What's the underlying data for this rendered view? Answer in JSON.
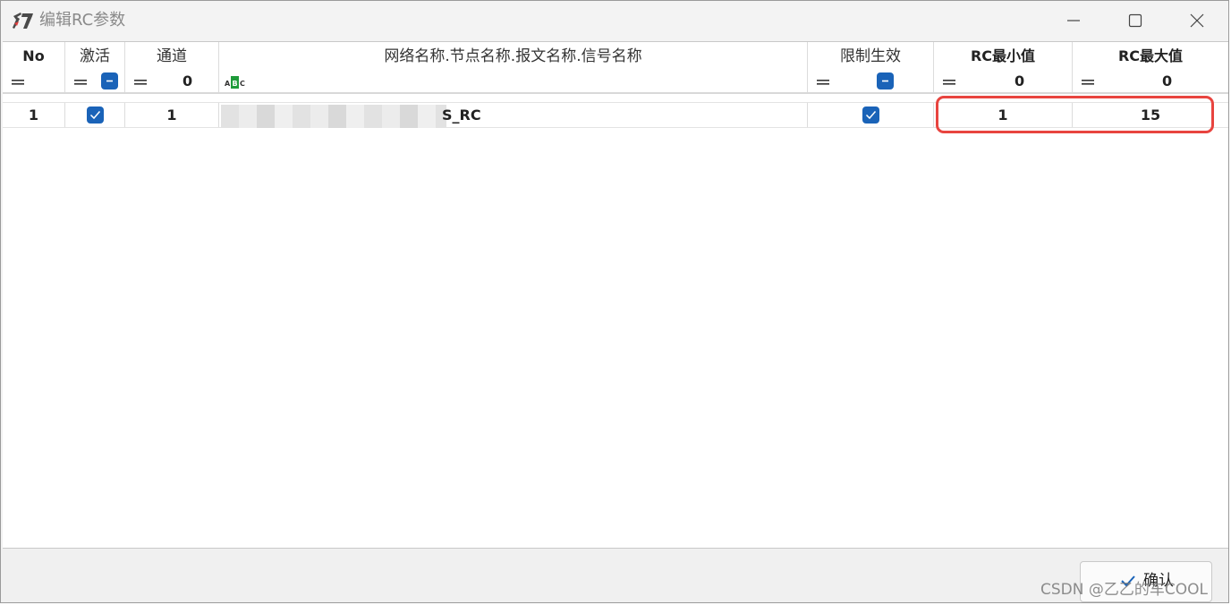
{
  "window": {
    "title": "编辑RC参数",
    "accent_color": "#1a63b8",
    "highlight_color": "#e8443f"
  },
  "table": {
    "columns": [
      {
        "label": "No",
        "filter_op": "="
      },
      {
        "label": "激活",
        "filter_op": "="
      },
      {
        "label": "通道",
        "filter_op": "=",
        "filter_value": "0"
      },
      {
        "label": "网络名称.节点名称.报文名称.信号名称"
      },
      {
        "label": "限制生效",
        "filter_op": "="
      },
      {
        "label": "RC最小值",
        "filter_op": "=",
        "filter_value": "0"
      },
      {
        "label": "RC最大值",
        "filter_op": "=",
        "filter_value": "0"
      }
    ],
    "rows": [
      {
        "no": "1",
        "active": true,
        "channel": "1",
        "name_visible_suffix": "S_RC",
        "limit_enabled": true,
        "rc_min": "1",
        "rc_max": "15"
      }
    ]
  },
  "footer": {
    "confirm_label": "确认",
    "watermark": "CSDN @乙乙的车COOL"
  }
}
